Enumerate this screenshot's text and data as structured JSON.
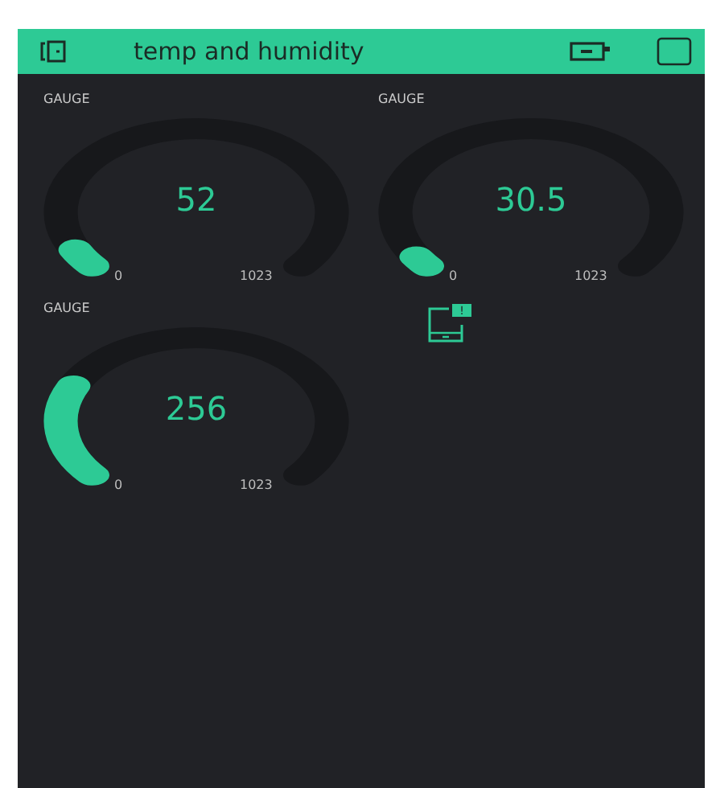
{
  "header": {
    "title": "temp and humidity"
  },
  "gauges": [
    {
      "label": "GAUGE",
      "value": "52",
      "min": "0",
      "max": "1023"
    },
    {
      "label": "GAUGE",
      "value": "30.5",
      "min": "0",
      "max": "1023"
    },
    {
      "label": "GAUGE",
      "value": "256",
      "min": "0",
      "max": "1023"
    }
  ],
  "notification_widget": {
    "badge": "!"
  }
}
